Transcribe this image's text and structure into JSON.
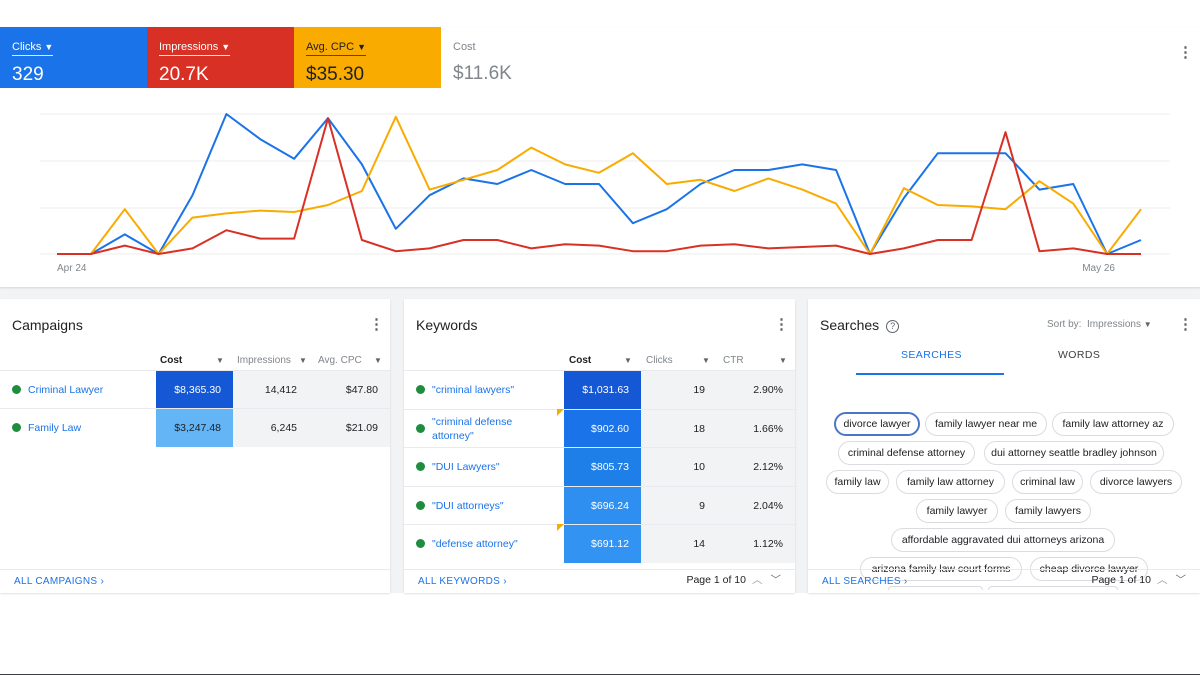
{
  "metrics": [
    {
      "label": "Clicks",
      "value": "329",
      "color": "#1a73e8",
      "selected": true
    },
    {
      "label": "Impressions",
      "value": "20.7K",
      "color": "#d93025",
      "selected": true
    },
    {
      "label": "Avg. CPC",
      "value": "$35.30",
      "color": "#f9ab00",
      "selected": true
    },
    {
      "label": "Cost",
      "value": "$11.6K",
      "color": "#ffffff",
      "selected": false
    }
  ],
  "chart_data": {
    "type": "line",
    "x_start_label": "Apr 24",
    "x_end_label": "May 26",
    "grid": true,
    "series": [
      {
        "color": "#1a73e8",
        "values": [
          0,
          0,
          14,
          0,
          42,
          100,
          82,
          68,
          97,
          64,
          18,
          42,
          54,
          50,
          60,
          50,
          50,
          22,
          32,
          50,
          60,
          60,
          64,
          60,
          0,
          40,
          72,
          72,
          72,
          46,
          50,
          0,
          10
        ]
      },
      {
        "color": "#f9ab00",
        "values": [
          0,
          0,
          32,
          0,
          26,
          29,
          31,
          30,
          35,
          45,
          98,
          46,
          53,
          60,
          76,
          64,
          58,
          72,
          50,
          53,
          45,
          54,
          46,
          36,
          0,
          47,
          35,
          34,
          32,
          52,
          36,
          0,
          32
        ]
      },
      {
        "color": "#d93025",
        "values": [
          0,
          0,
          6,
          0,
          4,
          17,
          11,
          11,
          97,
          10,
          2,
          4,
          10,
          10,
          4,
          7,
          6,
          2,
          2,
          6,
          7,
          4,
          5,
          6,
          0,
          4,
          10,
          10,
          87,
          2,
          4,
          0,
          0
        ]
      }
    ]
  },
  "campaigns": {
    "title": "Campaigns",
    "columns": [
      "Cost",
      "Impressions",
      "Avg. CPC"
    ],
    "rows": [
      {
        "name": "Criminal Lawyer",
        "cost": "$8,365.30",
        "impressions": "14,412",
        "cpc": "$47.80",
        "cost_color": "#1558d6"
      },
      {
        "name": "Family Law",
        "cost": "$3,247.48",
        "impressions": "6,245",
        "cpc": "$21.09",
        "cost_color": "#64b5f6"
      }
    ],
    "footer": "ALL CAMPAIGNS"
  },
  "keywords": {
    "title": "Keywords",
    "columns": [
      "Cost",
      "Clicks",
      "CTR"
    ],
    "rows": [
      {
        "name": "\"criminal lawyers\"",
        "cost": "$1,031.63",
        "clicks": "19",
        "ctr": "2.90%",
        "cost_color": "#1558d6",
        "flag": false
      },
      {
        "name": "\"criminal defense attorney\"",
        "cost": "$902.60",
        "clicks": "18",
        "ctr": "1.66%",
        "cost_color": "#1a73e8",
        "flag": true
      },
      {
        "name": "\"DUI Lawyers\"",
        "cost": "$805.73",
        "clicks": "10",
        "ctr": "2.12%",
        "cost_color": "#1e7fe8",
        "flag": false
      },
      {
        "name": "\"DUI attorneys\"",
        "cost": "$696.24",
        "clicks": "9",
        "ctr": "2.04%",
        "cost_color": "#2f8ff0",
        "flag": false
      },
      {
        "name": "\"defense attorney\"",
        "cost": "$691.12",
        "clicks": "14",
        "ctr": "1.12%",
        "cost_color": "#3393f2",
        "flag": true
      }
    ],
    "footer": "ALL KEYWORDS",
    "pager": "Page 1 of 10"
  },
  "searches": {
    "title": "Searches",
    "sort_by_label": "Sort by:",
    "sort_by_value": "Impressions",
    "tabs": [
      "SEARCHES",
      "WORDS"
    ],
    "chips": [
      "divorce lawyer",
      "family lawyer near me",
      "family law attorney az",
      "criminal defense attorney",
      "dui attorney seattle bradley johnson",
      "family law",
      "family law attorney",
      "criminal law",
      "divorce lawyers",
      "family lawyer",
      "family lawyers",
      "affordable aggravated dui attorneys arizona",
      "arizona family law court forms",
      "cheap divorce lawyer"
    ],
    "footer": "ALL SEARCHES",
    "pager": "Page 1 of 10"
  }
}
